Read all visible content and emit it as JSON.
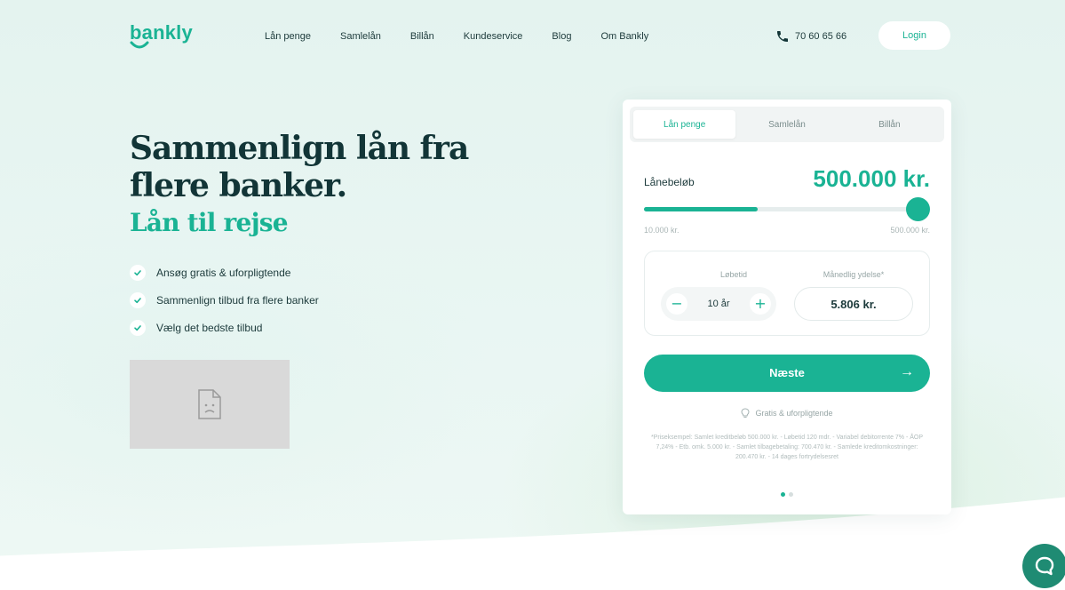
{
  "brand": {
    "name": "bankly",
    "accent": "#1ab394",
    "dark": "#123537"
  },
  "nav": {
    "links": [
      "Lån penge",
      "Samlelån",
      "Billån",
      "Kundeservice",
      "Blog",
      "Om Bankly"
    ],
    "phone": "70 60 65 66",
    "login_label": "Login"
  },
  "hero": {
    "headline": "Sammenlign lån fra flere banker.",
    "subheadline": "Lån til rejse",
    "benefits": [
      "Ansøg gratis & uforpligtende",
      "Sammenlign tilbud fra flere banker",
      "Vælg det bedste tilbud"
    ]
  },
  "calculator": {
    "tabs": [
      {
        "label": "Lån penge",
        "active": true
      },
      {
        "label": "Samlelån",
        "active": false
      },
      {
        "label": "Billån",
        "active": false
      }
    ],
    "amount_label": "Lånebeløb",
    "amount_value": "500.000 kr.",
    "slider": {
      "min_label": "10.000 kr.",
      "max_label": "500.000 kr.",
      "fill_fraction": 0.4,
      "thumb_fraction": 1.0
    },
    "term_label": "Løbetid",
    "term_value": "10 år",
    "payment_label": "Månedlig ydelse*",
    "payment_value": "5.806 kr.",
    "next_label": "Næste",
    "next_arrow": "→",
    "free_note": "Gratis & uforpligtende",
    "disclaimer": "*Priseksempel: Samlet kreditbeløb 500.000 kr. - Løbetid 120 mdr. - Variabel debitorrente 7% - ÅOP 7,24% - Etb. omk. 5.000 kr. - Samlet tilbagebetaling: 700.470 kr. - Samlede kreditomkostninger: 200.470 kr. - 14 dages fortrydelsesret",
    "pagination": {
      "count": 2,
      "active": 0
    }
  }
}
